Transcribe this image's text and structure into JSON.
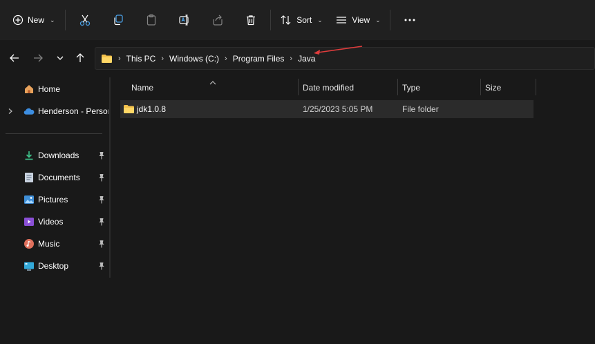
{
  "toolbar": {
    "new_label": "New",
    "sort_label": "Sort",
    "view_label": "View",
    "icons": [
      "plus-circle-icon",
      "cut-icon",
      "copy-icon",
      "paste-icon",
      "rename-icon",
      "share-icon",
      "delete-icon",
      "sort-icon",
      "view-icon",
      "more-icon"
    ]
  },
  "address": {
    "breadcrumbs": [
      "This PC",
      "Windows (C:)",
      "Program Files",
      "Java"
    ],
    "annotation_color": "#e03c3c"
  },
  "sidebar": {
    "items": [
      {
        "label": "Home",
        "icon": "home-icon"
      },
      {
        "label": "Henderson - Persor",
        "icon": "onedrive-icon"
      },
      {
        "label": "Downloads",
        "icon": "download-icon",
        "pinned": true
      },
      {
        "label": "Documents",
        "icon": "documents-icon",
        "pinned": true
      },
      {
        "label": "Pictures",
        "icon": "pictures-icon",
        "pinned": true
      },
      {
        "label": "Videos",
        "icon": "videos-icon",
        "pinned": true
      },
      {
        "label": "Music",
        "icon": "music-icon",
        "pinned": true
      },
      {
        "label": "Desktop",
        "icon": "desktop-icon",
        "pinned": true
      }
    ]
  },
  "files": {
    "columns": {
      "name": "Name",
      "date": "Date modified",
      "type": "Type",
      "size": "Size"
    },
    "rows": [
      {
        "name": "jdk1.0.8",
        "date": "1/25/2023 5:05 PM",
        "type": "File folder",
        "size": ""
      }
    ]
  },
  "colors": {
    "background": "#191919",
    "toolbar": "#202020",
    "selected_row": "#2b2b2b",
    "folder": "#f4c24d",
    "accent_blue": "#4aa0e6"
  }
}
